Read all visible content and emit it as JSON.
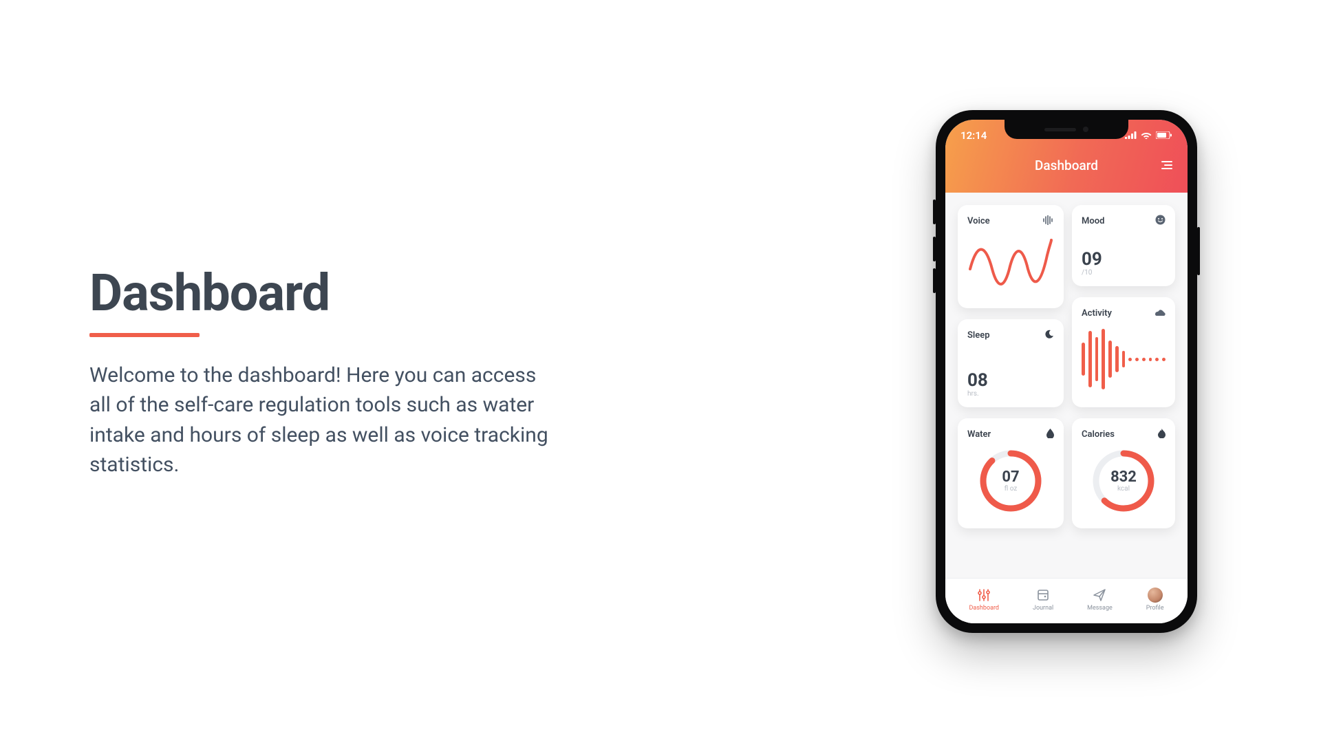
{
  "page": {
    "heading": "Dashboard",
    "description": "Welcome to the dashboard! Here you can access all of the self-care regulation tools such as water intake and hours of sleep as well as voice tracking statistics."
  },
  "phone": {
    "status": {
      "time": "12:14"
    },
    "header": {
      "title": "Dashboard"
    },
    "cards": {
      "voice": {
        "title": "Voice"
      },
      "mood": {
        "title": "Mood",
        "value": "09",
        "unit": "/10"
      },
      "sleep": {
        "title": "Sleep",
        "value": "08",
        "unit": "hrs."
      },
      "activity": {
        "title": "Activity"
      },
      "water": {
        "title": "Water",
        "value": "07",
        "unit": "fl oz"
      },
      "calories": {
        "title": "Calories",
        "value": "832",
        "unit": "kcal"
      }
    },
    "tabs": {
      "dashboard": "Dashboard",
      "journal": "Journal",
      "message": "Message",
      "profile": "Profile"
    }
  },
  "colors": {
    "accent": "#f05e4a",
    "text": "#3d4651"
  }
}
